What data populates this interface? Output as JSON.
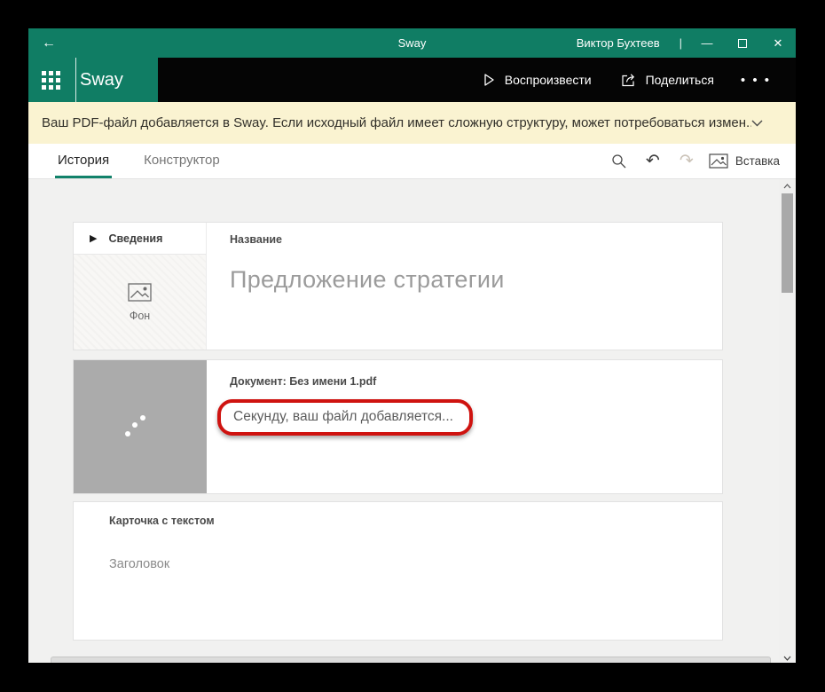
{
  "titlebar": {
    "title": "Sway",
    "user": "Виктор Бухтеев",
    "divider": "|",
    "minimize_glyph": "—",
    "close_glyph": "✕",
    "back_glyph": "←"
  },
  "appbar": {
    "logo": "Sway",
    "play_label": "Воспроизвести",
    "share_label": "Поделиться",
    "more_glyph": "• • •"
  },
  "banner": {
    "text": "Ваш PDF-файл добавляется в Sway. Если исходный файл имеет сложную структуру, может потребоваться измен..."
  },
  "tabs": [
    {
      "label": "История",
      "active": true
    },
    {
      "label": "Конструктор",
      "active": false
    }
  ],
  "toolbar": {
    "undo_glyph": "↶",
    "redo_glyph": "↷",
    "insert_label": "Вставка"
  },
  "cards": {
    "title_card": {
      "details_arrow": "▶",
      "details_label": "Сведения",
      "background_label": "Фон",
      "name_label": "Название",
      "title_value": "Предложение стратегии"
    },
    "document_card": {
      "header": "Документ: Без имени 1.pdf",
      "status": "Секунду, ваш файл добавляется..."
    },
    "text_card": {
      "header": "Карточка с текстом",
      "placeholder": "Заголовок"
    }
  },
  "colors": {
    "accent_teal": "#107d64",
    "banner_yellow": "#faf3d1",
    "annotation_red": "#cf1310",
    "thumbnail_gray": "#ababab"
  },
  "icons": [
    "back-arrow-icon",
    "waffle-menu-icon",
    "play-icon",
    "share-icon",
    "more-icon",
    "chevron-down-icon",
    "search-icon",
    "undo-icon",
    "redo-icon",
    "insert-image-icon",
    "details-arrow-icon",
    "background-image-icon",
    "loading-spinner",
    "scroll-up-icon",
    "scroll-down-icon"
  ]
}
